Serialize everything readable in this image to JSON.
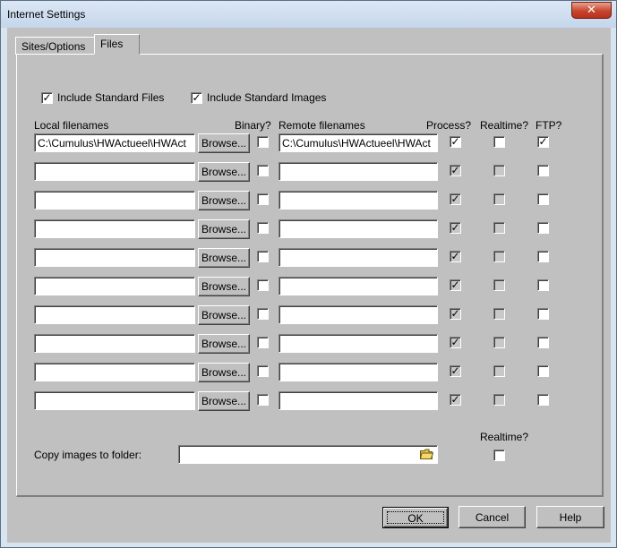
{
  "window": {
    "title": "Internet Settings",
    "close_label": "✕"
  },
  "tabs": [
    {
      "label": "Sites/Options"
    },
    {
      "label": "Files"
    }
  ],
  "options": {
    "include_standard_files": {
      "label": "Include Standard Files",
      "checked": true
    },
    "include_standard_images": {
      "label": "Include Standard Images",
      "checked": true
    }
  },
  "headers": {
    "local": "Local filenames",
    "binary": "Binary?",
    "remote": "Remote filenames",
    "process": "Process?",
    "realtime": "Realtime?",
    "ftp": "FTP?"
  },
  "browse_label": "Browse...",
  "rows": [
    {
      "local": "C:\\Cumulus\\HWActueel\\HWAct",
      "binary": false,
      "remote": "C:\\Cumulus\\HWActueel\\HWAct",
      "process": true,
      "realtime": false,
      "ftp": true
    },
    {
      "local": "",
      "binary": false,
      "remote": "",
      "process": true,
      "realtime": false,
      "ftp": false
    },
    {
      "local": "",
      "binary": false,
      "remote": "",
      "process": true,
      "realtime": false,
      "ftp": false
    },
    {
      "local": "",
      "binary": false,
      "remote": "",
      "process": true,
      "realtime": false,
      "ftp": false
    },
    {
      "local": "",
      "binary": false,
      "remote": "",
      "process": true,
      "realtime": false,
      "ftp": false
    },
    {
      "local": "",
      "binary": false,
      "remote": "",
      "process": true,
      "realtime": false,
      "ftp": false
    },
    {
      "local": "",
      "binary": false,
      "remote": "",
      "process": true,
      "realtime": false,
      "ftp": false
    },
    {
      "local": "",
      "binary": false,
      "remote": "",
      "process": true,
      "realtime": false,
      "ftp": false
    },
    {
      "local": "",
      "binary": false,
      "remote": "",
      "process": true,
      "realtime": false,
      "ftp": false
    },
    {
      "local": "",
      "binary": false,
      "remote": "",
      "process": true,
      "realtime": false,
      "ftp": false
    }
  ],
  "copy_images": {
    "label": "Copy images to folder:",
    "value": "",
    "realtime_label": "Realtime?",
    "realtime": false,
    "folder_icon": "folder-open-icon"
  },
  "buttons": {
    "ok": "OK",
    "cancel": "Cancel",
    "help": "Help"
  },
  "colors": {
    "dialog_bg": "#c0c0c0",
    "titlebar": "#d9e4f1",
    "close": "#c7452c"
  }
}
